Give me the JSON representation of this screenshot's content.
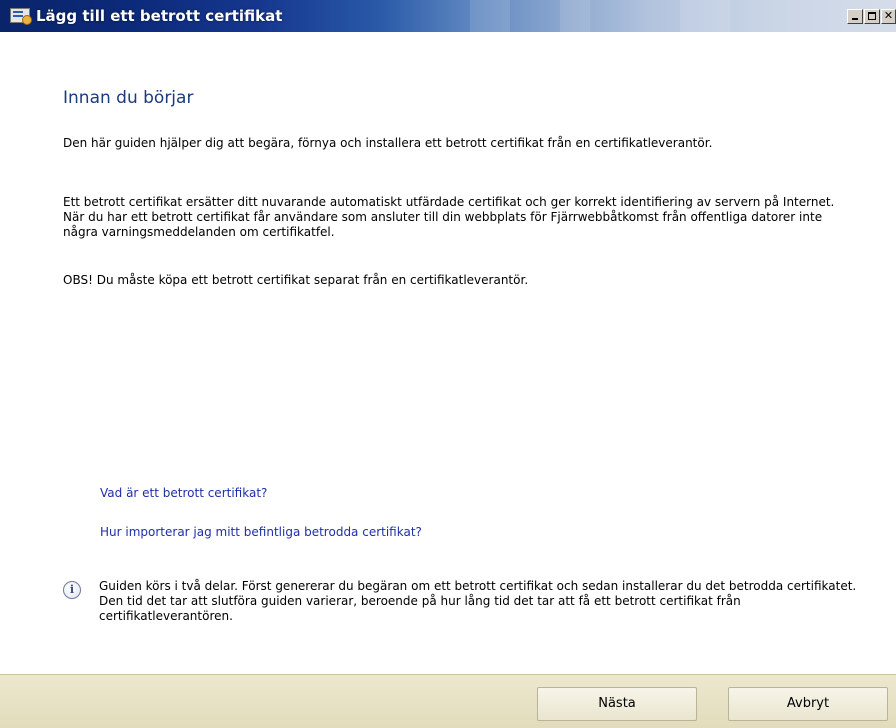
{
  "window": {
    "title": "Lägg till ett betrott certifikat"
  },
  "page": {
    "heading": "Innan du börjar",
    "paragraphs": [
      "Den här guiden hjälper dig att begära, förnya och installera ett betrott certifikat från en certifikatleverantör.",
      "Ett betrott certifikat ersätter ditt nuvarande automatiskt utfärdade certifikat och ger korrekt identifiering av servern på Internet. När du har ett betrott certifikat får användare som ansluter till din webbplats för Fjärrwebbåtkomst från offentliga datorer inte några varningsmeddelanden om certifikatfel.",
      "OBS! Du måste köpa ett betrott certifikat separat från en certifikatleverantör."
    ],
    "links": [
      "Vad är ett betrott certifikat?",
      "Hur importerar jag mitt befintliga betrodda certifikat?"
    ],
    "info_text": "Guiden körs i två delar. Först genererar du begäran om ett betrott certifikat och sedan installerar du det betrodda certifikatet. Den tid det tar att slutföra guiden varierar, beroende på hur lång tid det tar att få ett betrott certifikat från certifikatleverantören."
  },
  "footer": {
    "next_label": "Nästa",
    "cancel_label": "Avbryt"
  },
  "colors": {
    "heading": "#1c3a7c",
    "link": "#1f2fa8",
    "footer_bg": "#e6e1c6"
  },
  "icons": {
    "window_icon": "certificate-icon",
    "info_icon": "info-icon"
  }
}
